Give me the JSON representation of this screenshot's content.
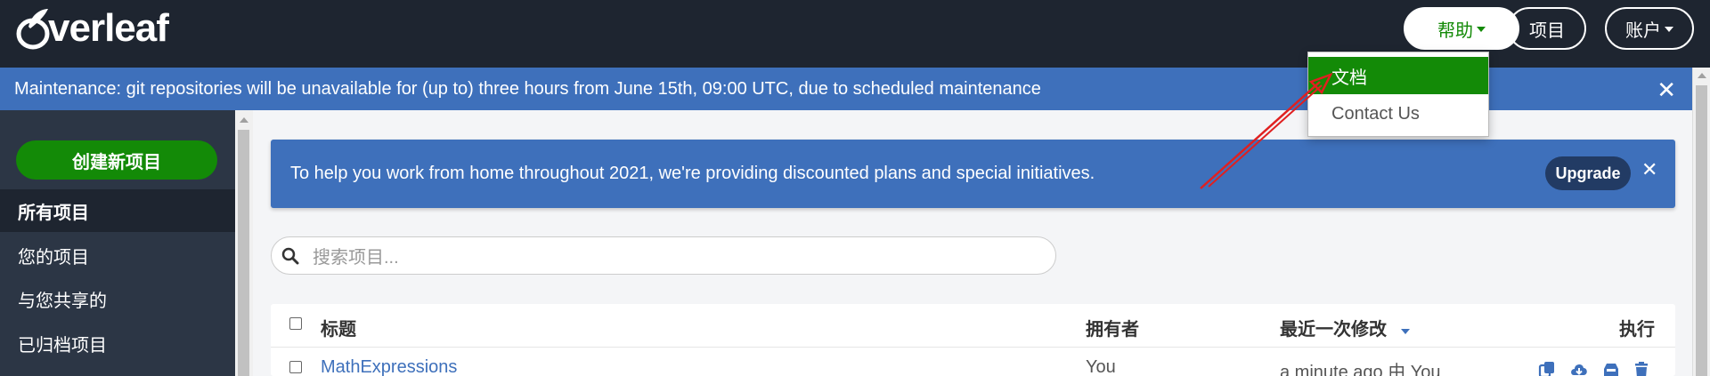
{
  "navbar": {
    "logo_text": "verleaf",
    "help_label": "帮助",
    "projects_label": "项目",
    "account_label": "账户"
  },
  "help_menu": {
    "items": [
      {
        "label": "文档",
        "active": true
      },
      {
        "label": "Contact Us",
        "active": false
      }
    ]
  },
  "maintenance": {
    "message": "Maintenance: git repositories will be unavailable for (up to) three hours from June 15th, 09:00 UTC, due to scheduled maintenance",
    "close": "✕"
  },
  "sidebar": {
    "create_label": "创建新项目",
    "items": [
      {
        "label": "所有项目",
        "active": true
      },
      {
        "label": "您的项目",
        "active": false
      },
      {
        "label": "与您共享的",
        "active": false
      },
      {
        "label": "已归档项目",
        "active": false
      }
    ]
  },
  "promo": {
    "message": "To help you work from home throughout 2021, we're providing discounted plans and special initiatives.",
    "upgrade_label": "Upgrade",
    "close": "✕"
  },
  "search": {
    "placeholder": "搜索项目..."
  },
  "table": {
    "headers": {
      "title": "标题",
      "owner": "拥有者",
      "modified": "最近一次修改",
      "actions": "执行"
    },
    "rows": [
      {
        "title": "MathExpressions",
        "owner": "You",
        "modified": "a minute ago 由 You"
      }
    ]
  },
  "colors": {
    "navbar_bg": "#1e2530",
    "accent_green": "#138a07",
    "banner_blue": "#3e70bb",
    "sidebar_bg": "#2c3645",
    "annotation_red": "#e02020"
  }
}
